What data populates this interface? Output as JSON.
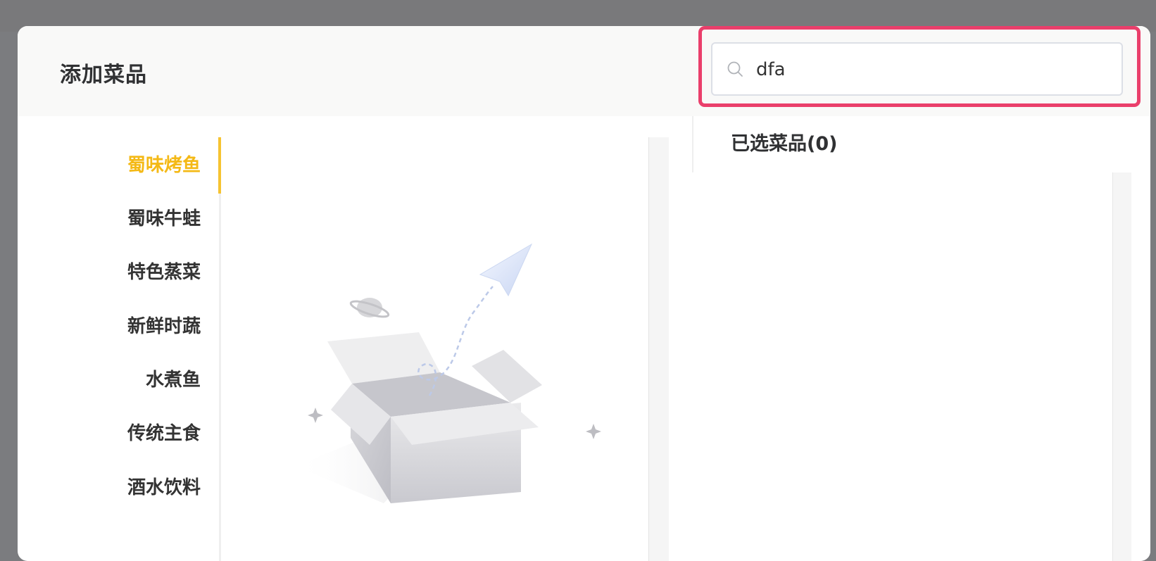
{
  "modal": {
    "title": "添加菜品"
  },
  "search": {
    "value": "dfa",
    "icon": "search-icon"
  },
  "categories": [
    {
      "label": "蜀味烤鱼",
      "active": true
    },
    {
      "label": "蜀味牛蛙",
      "active": false
    },
    {
      "label": "特色蒸菜",
      "active": false
    },
    {
      "label": "新鲜时蔬",
      "active": false
    },
    {
      "label": "水煮鱼",
      "active": false
    },
    {
      "label": "传统主食",
      "active": false
    },
    {
      "label": "酒水饮料",
      "active": false
    }
  ],
  "selected": {
    "title": "已选菜品(0)"
  },
  "colors": {
    "accent": "#f4b916",
    "highlight": "#ea3f6b",
    "text": "#303133"
  }
}
